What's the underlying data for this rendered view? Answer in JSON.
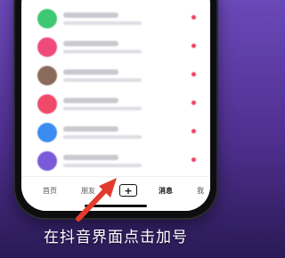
{
  "tabbar": {
    "home_label": "首页",
    "friends_label": "朋友",
    "plus_symbol": "+",
    "messages_label": "消息",
    "me_label": "我"
  },
  "messages": [
    {
      "avatar_color": "#3fc874"
    },
    {
      "avatar_color": "#f04a7a"
    },
    {
      "avatar_color": "#8a6a5a"
    },
    {
      "avatar_color": "#f04a6a"
    },
    {
      "avatar_color": "#3a8cf0"
    },
    {
      "avatar_color": "#7a5ad8"
    }
  ],
  "caption": "在抖音界面点击加号",
  "colors": {
    "arrow": "#e23b2e",
    "badge": "#f03a5f"
  }
}
